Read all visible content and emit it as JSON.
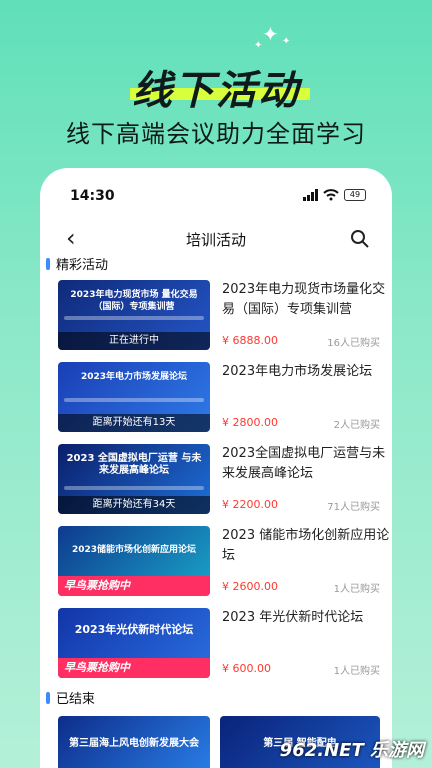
{
  "promo": {
    "title": "线下活动",
    "subtitle": "线下高端会议助力全面学习"
  },
  "statusbar": {
    "time": "14:30",
    "battery": "49"
  },
  "header": {
    "title": "培训活动",
    "back_icon": "chevron-left-icon",
    "search_icon": "search-icon"
  },
  "sections": {
    "featured": "精彩活动",
    "ended": "已结束"
  },
  "colors": {
    "accent": "#3a8bff",
    "price": "#ff3a2f",
    "earlybird": "#ff2e63"
  },
  "events": [
    {
      "title": "2023年电力现货市场量化交易（国际）专项集训营",
      "thumb_title": "2023年电力现货市场 量化交易（国际）专项集训营",
      "status": "正在进行中",
      "price": "¥ 6888.00",
      "buyers": "16人已购买"
    },
    {
      "title": "2023年电力市场发展论坛",
      "thumb_title": "2023年电力市场发展论坛",
      "status": "距离开始还有13天",
      "price": "¥ 2800.00",
      "buyers": "2人已购买"
    },
    {
      "title": "2023全国虚拟电厂运营与未来发展高峰论坛",
      "thumb_title": "2023 全国虚拟电厂运营 与未来发展高峰论坛",
      "status": "距离开始还有34天",
      "price": "¥ 2200.00",
      "buyers": "71人已购买"
    },
    {
      "title": "2023 储能市场化创新应用论坛",
      "thumb_title": "2023储能市场化创新应用论坛",
      "status": "早鸟票抢购中",
      "price": "¥ 2600.00",
      "buyers": "1人已购买"
    },
    {
      "title": "2023 年光伏新时代论坛",
      "thumb_title": "2023年光伏新时代论坛",
      "status": "早鸟票抢购中",
      "price": "¥ 600.00",
      "buyers": "1人已购买"
    }
  ],
  "ended_events": [
    {
      "thumb_title": "第三届海上风电创新发展大会"
    },
    {
      "thumb_title": "第三届 智能配电"
    }
  ],
  "watermark": "962.NET 乐游网"
}
